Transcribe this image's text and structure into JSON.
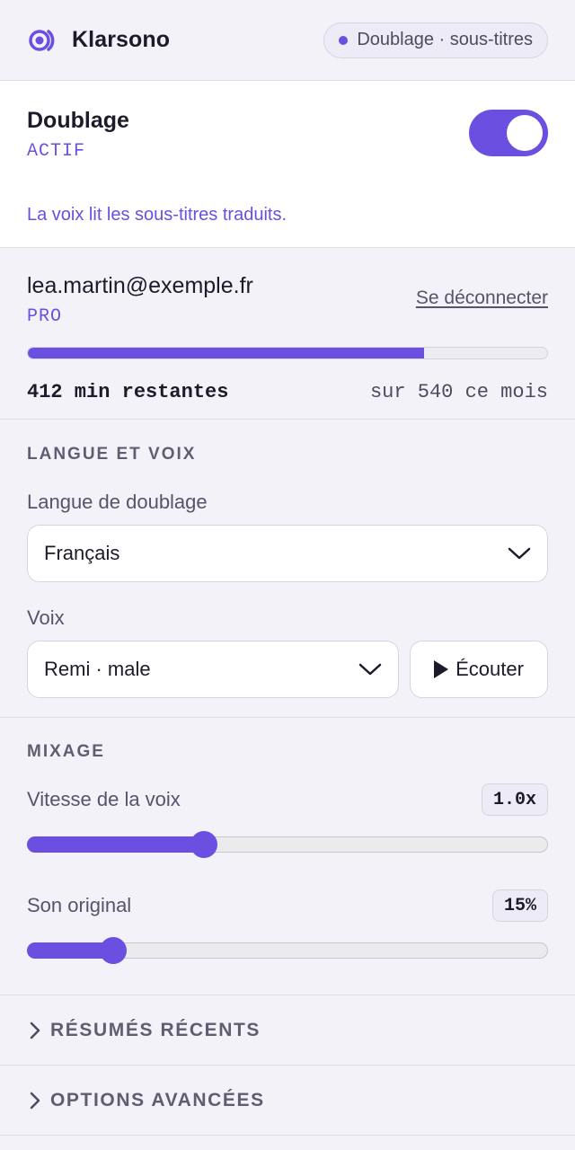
{
  "header": {
    "app_name": "Klarsono",
    "status_label": "Doublage · sous-titres",
    "logo_icon": "target-icon"
  },
  "dubbing": {
    "title": "Doublage",
    "state": "ACTIF",
    "enabled": true,
    "description": "La voix lit les sous-titres traduits."
  },
  "account": {
    "email": "lea.martin@exemple.fr",
    "plan": "PRO",
    "logout_label": "Se déconnecter",
    "minutes_remaining_label": "412 min restantes",
    "minutes_total_label": "sur 540 ce mois",
    "minutes_remaining": 412,
    "minutes_total": 540
  },
  "language_voice": {
    "section_title": "LANGUE ET VOIX",
    "language_label": "Langue de doublage",
    "language_value": "Français",
    "voice_label": "Voix",
    "voice_value": "Remi · male",
    "listen_label": "Écouter"
  },
  "mix": {
    "section_title": "MIXAGE",
    "speed_label": "Vitesse de la voix",
    "speed_value": "1.0x",
    "speed_fraction": 0.34,
    "original_label": "Son original",
    "original_value": "15%",
    "original_fraction": 0.165
  },
  "collapsibles": {
    "recent_summaries": "RÉSUMÉS RÉCENTS",
    "advanced_options": "OPTIONS AVANCÉES"
  },
  "colors": {
    "accent": "#6b4fe0",
    "background": "#f3f2f8",
    "card": "#ffffff"
  }
}
